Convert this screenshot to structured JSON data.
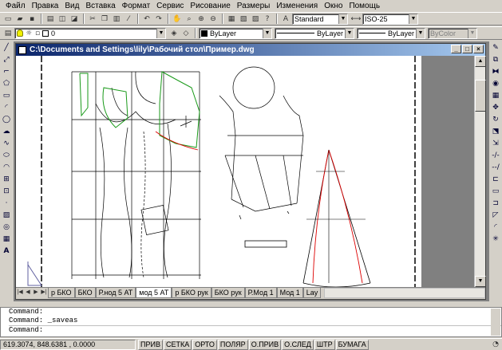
{
  "menu": [
    "Файл",
    "Правка",
    "Вид",
    "Вставка",
    "Формат",
    "Сервис",
    "Рисование",
    "Размеры",
    "Изменения",
    "Окно",
    "Помощь"
  ],
  "toolbar": {
    "text_style": "Standard",
    "dim_style": "ISO-25"
  },
  "properties": {
    "layer": "0",
    "color": "ByLayer",
    "linetype": "ByLayer",
    "lineweight": "ByLayer",
    "plotstyle": "ByColor"
  },
  "drawing_window": {
    "title": "C:\\Documents and Settings\\lily\\Рабочий стол\\Пример.dwg"
  },
  "layout_tabs": [
    "р БКО",
    "БКО",
    "Р.нод 5 АТ",
    "мод 5 АТ",
    "р БКО рук",
    "БКО рук",
    "Р.Мод 1",
    "Мод 1",
    "Lay"
  ],
  "command_lines": [
    "Command:",
    "Command: _saveas"
  ],
  "command_prompt": "Command:",
  "status": {
    "coords": "619.3074, 848.6381 , 0.0000",
    "toggles": [
      "ПРИВ",
      "СЕТКА",
      "ОРТО",
      "ПОЛЯР",
      "О.ПРИВ",
      "О.СЛЕД",
      "ШТР",
      "БУМАГА"
    ]
  },
  "colors": {
    "title_active": "#0a246a",
    "pattern_green": "#1a9a1a",
    "pattern_red": "#dd0000"
  }
}
